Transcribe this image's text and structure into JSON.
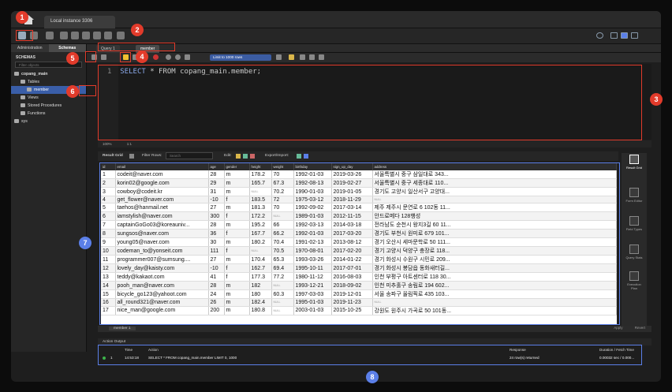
{
  "window": {
    "connection_tab": "Local instance 3306"
  },
  "sidebar": {
    "tabs": [
      "Administration",
      "Schemas"
    ],
    "title": "SCHEMAS",
    "filter_placeholder": "Filter objects",
    "tree": [
      "copang_main",
      "Tables",
      "member",
      "Views",
      "Stored Procedures",
      "Functions",
      "sys"
    ]
  },
  "editor": {
    "tabs": [
      "Query 1",
      "member"
    ],
    "limit_select": "Limit to 1000 rows",
    "line_number": "1",
    "sql_keyword": "SELECT",
    "sql_rest": " * FROM copang_main.member;",
    "zoom": "100%",
    "cursor_pos": "1:1"
  },
  "result": {
    "toolbar": {
      "result_grid": "Result Grid",
      "filter_rows": "Filter Rows:",
      "search_placeholder": "Search",
      "edit": "Edit:",
      "export_import": "Export/Import:"
    },
    "columns": [
      "id",
      "email",
      "age",
      "gender",
      "height",
      "weight",
      "birthday",
      "sign_up_day",
      "address"
    ],
    "rows": [
      [
        "1",
        "codeit@naver.com",
        "28",
        "m",
        "178.2",
        "70",
        "1992-01-03",
        "2019-03-26",
        "서울특별시 중구 삼일대로 343..."
      ],
      [
        "2",
        "korin02@google.com",
        "29",
        "m",
        "165.7",
        "67.3",
        "1992-08-13",
        "2019-02-27",
        "서울특별시 중구 세종대로 110..."
      ],
      [
        "3",
        "cowboy@codeit.kr",
        "31",
        "m",
        "NULL",
        "70.2",
        "1990-01-03",
        "2019-01-05",
        "경기도 고양시 일산서구 고양대..."
      ],
      [
        "4",
        "get_flower@naver.com",
        "-10",
        "f",
        "183.5",
        "72",
        "1975-03-12",
        "2018-11-29",
        "NULL"
      ],
      [
        "5",
        "taehos@hanmail.net",
        "27",
        "m",
        "181.3",
        "70",
        "1992-09-02",
        "2017-03-14",
        "제주 제주시 문연로 6 102동 11..."
      ],
      [
        "6",
        "iamstylish@naver.com",
        "300",
        "f",
        "172.2",
        "NULL",
        "1989-01-03",
        "2012-11-15",
        "안드로메다 128행성"
      ],
      [
        "7",
        "captainGoGo03@koreauniv...",
        "28",
        "m",
        "195.2",
        "66",
        "1992-03-13",
        "2014-03-18",
        "전라남도 순천시 왕지3길 60 11..."
      ],
      [
        "8",
        "sungsos@naver.com",
        "36",
        "f",
        "167.7",
        "66.2",
        "1992-01-03",
        "2017-03-20",
        "경기도 부천시 원미로 679 101..."
      ],
      [
        "9",
        "young05@naver.com",
        "30",
        "m",
        "180.2",
        "70.4",
        "1991-02-13",
        "2013-08-12",
        "경기 오산시 세마문학로 50 111..."
      ],
      [
        "10",
        "codeman_to@yonseit.com",
        "111",
        "f",
        "NULL",
        "70.5",
        "1970-08-01",
        "2017-02-20",
        "경기 고양시 덕양구 충장로 118..."
      ],
      [
        "11",
        "programmer007@sumsung....",
        "27",
        "m",
        "170.4",
        "65.3",
        "1993-03-26",
        "2014-01-22",
        "경기 화성시 수원구 시민로 209..."
      ],
      [
        "12",
        "lovely_day@kaisty.com",
        "-10",
        "f",
        "162.7",
        "69.4",
        "1995-10-11",
        "2017-07-01",
        "경기 화성시 봉담읍 동화새터길..."
      ],
      [
        "13",
        "teddy@kakaot.com",
        "41",
        "f",
        "177.3",
        "77.2",
        "1980-11-12",
        "2016-08-03",
        "인천 부평구 아트센터로 118 30..."
      ],
      [
        "14",
        "pooh_man@naver.com",
        "28",
        "m",
        "182",
        "NULL",
        "1993-12-21",
        "2018-09-02",
        "인천 미추홀구 송림로 194 602..."
      ],
      [
        "15",
        "bicycle_go123@yahoot.com",
        "24",
        "m",
        "180",
        "60.3",
        "1997-03-03",
        "2019-12-01",
        "서울 송파구 올림픽로 435 103..."
      ],
      [
        "16",
        "all_round321@naver.com",
        "26",
        "m",
        "182.4",
        "NULL",
        "1995-01-03",
        "2019-11-23",
        "NULL"
      ],
      [
        "17",
        "nice_man@google.com",
        "200",
        "m",
        "180.8",
        "NULL",
        "2003-01-03",
        "2015-10-25",
        "강원도 원주시 가곡로 50 101동..."
      ]
    ],
    "result_tab": "member 1",
    "apply": "Apply",
    "revert": "Revert"
  },
  "right_panel": {
    "items": [
      "Result Grid",
      "Form Editor",
      "Field Types",
      "Query Stats",
      "Execution Plan"
    ]
  },
  "output": {
    "title": "Action Output",
    "headers": [
      "Time",
      "Action",
      "Response",
      "Duration / Fetch Time"
    ],
    "row": {
      "num": "1",
      "time": "14:53:18",
      "action": "SELECT * FROM copang_main.member LIMIT 0, 1000",
      "response": "24 row(s) returned",
      "duration": "0.00032 sec / 0.000..."
    }
  },
  "callouts": [
    "1",
    "2",
    "3",
    "4",
    "5",
    "6",
    "7",
    "8"
  ],
  "colors": {
    "callout_red": "#e23b2b",
    "callout_blue": "#5b7fe8",
    "selection": "#3a5ea8"
  }
}
